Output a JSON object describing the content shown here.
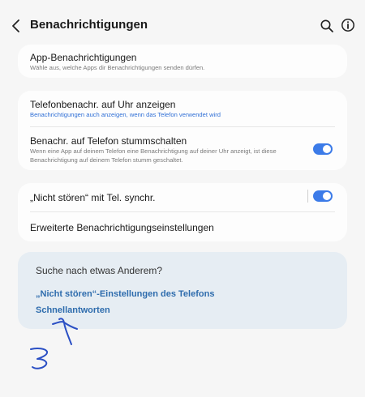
{
  "header": {
    "title": "Benachrichtigungen"
  },
  "card1": {
    "app_notifications": {
      "title": "App-Benachrichtigungen",
      "subtitle": "Wähle aus, welche Apps dir Benachrichtigungen senden dürfen."
    }
  },
  "card2": {
    "show_on_watch": {
      "title": "Telefonbenachr. auf Uhr anzeigen",
      "subtitle": "Benachrichtigungen auch anzeigen, wenn das Telefon verwendet wird"
    },
    "mute_on_phone": {
      "title": "Benachr. auf Telefon stummschalten",
      "subtitle": "Wenn eine App auf deinem Telefon eine Benachrichtigung auf deiner Uhr anzeigt, ist diese Benachrichtigung auf deinem Telefon stumm geschaltet.",
      "toggle_on": true
    }
  },
  "card3": {
    "dnd_sync": {
      "title": "„Nicht stören“ mit Tel. synchr.",
      "toggle_on": true
    },
    "advanced": {
      "title": "Erweiterte Benachrichtigungseinstellungen"
    }
  },
  "suggestions": {
    "title": "Suche nach etwas Anderem?",
    "links": [
      "„Nicht stören“-Einstellungen des Telefons",
      "Schnellantworten"
    ]
  },
  "colors": {
    "accent": "#3c7be8",
    "link": "#2e6cad",
    "annotation": "#2a4fc4"
  },
  "annotation": {
    "number": "3"
  }
}
